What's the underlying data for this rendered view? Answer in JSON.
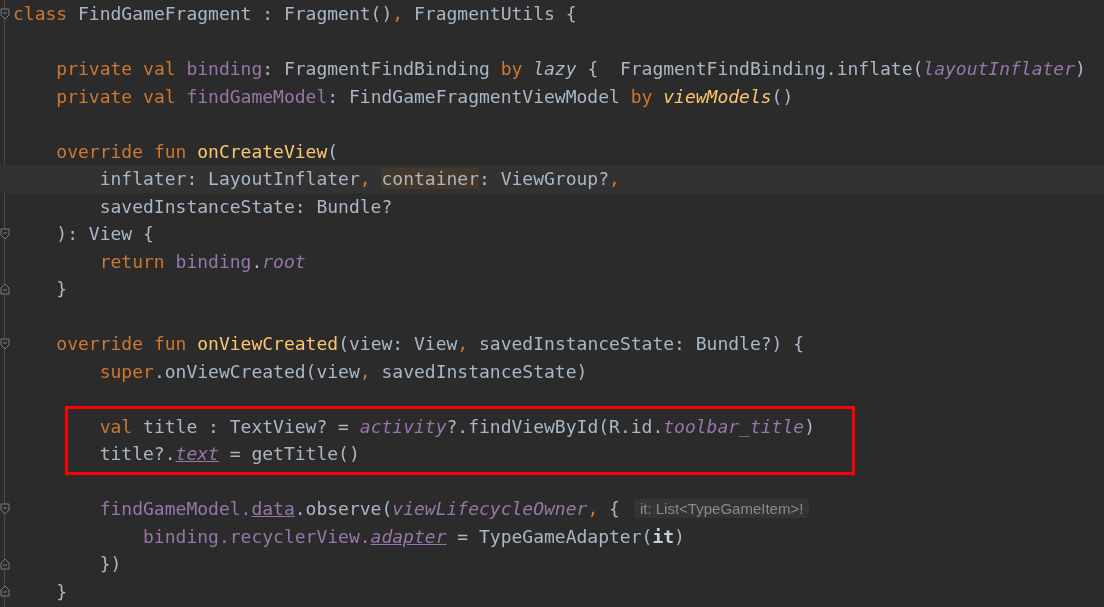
{
  "editor": {
    "lines": [
      {
        "kind": "code",
        "current": false,
        "boxed": false,
        "fold_start": true,
        "fold_end": false,
        "tokens": [
          {
            "kind": "keyword",
            "text": "class"
          },
          {
            "kind": "plain",
            "text": " FindGameFragment : Fragment()"
          },
          {
            "kind": "keyword",
            "text": ","
          },
          {
            "kind": "plain",
            "text": " FragmentUtils {"
          }
        ],
        "children": [
          {
            "kind": "blank",
            "current": false,
            "boxed": false,
            "fold_start": false,
            "fold_end": false
          },
          {
            "kind": "code",
            "current": false,
            "boxed": false,
            "fold_start": false,
            "fold_end": false,
            "tokens": [
              {
                "kind": "keyword",
                "text": "private val "
              },
              {
                "kind": "property",
                "text": "binding"
              },
              {
                "kind": "plain",
                "text": ": FragmentFindBinding "
              },
              {
                "kind": "keyword",
                "text": "by "
              },
              {
                "kind": "call_italic",
                "text": "lazy"
              },
              {
                "kind": "plain",
                "text": " {  FragmentFindBinding.inflate("
              },
              {
                "kind": "property_italic",
                "text": "layoutInflater"
              },
              {
                "kind": "plain",
                "text": ")"
              }
            ]
          },
          {
            "kind": "code",
            "current": false,
            "boxed": false,
            "fold_start": false,
            "fold_end": false,
            "tokens": [
              {
                "kind": "keyword",
                "text": "private val "
              },
              {
                "kind": "property",
                "text": "findGameModel"
              },
              {
                "kind": "plain",
                "text": ": FindGameFragmentViewModel "
              },
              {
                "kind": "keyword",
                "text": "by "
              },
              {
                "kind": "extension_italic",
                "text": "viewModels"
              },
              {
                "kind": "plain",
                "text": "()"
              }
            ]
          },
          {
            "kind": "blank",
            "current": false,
            "boxed": false,
            "fold_start": false,
            "fold_end": false
          },
          {
            "kind": "code",
            "current": false,
            "boxed": false,
            "fold_start": false,
            "fold_end": false,
            "tokens": [
              {
                "kind": "keyword",
                "text": "override fun "
              },
              {
                "kind": "declaration",
                "text": "onCreateView"
              },
              {
                "kind": "plain",
                "text": "("
              }
            ],
            "children": [
              {
                "kind": "code",
                "current": true,
                "boxed": false,
                "fold_start": false,
                "fold_end": false,
                "tokens": [
                  {
                    "kind": "plain",
                    "text": "inflater: LayoutInflater"
                  },
                  {
                    "kind": "keyword",
                    "text": ","
                  },
                  {
                    "kind": "usage",
                    "text": "container"
                  },
                  {
                    "kind": "plain",
                    "text": ": ViewGroup?"
                  },
                  {
                    "kind": "keyword",
                    "text": ","
                  }
                ]
              },
              {
                "kind": "code",
                "current": false,
                "boxed": false,
                "fold_start": false,
                "fold_end": false,
                "tokens": [
                  {
                    "kind": "plain",
                    "text": "savedInstanceState: Bundle?"
                  }
                ]
              }
            ]
          },
          {
            "kind": "code",
            "current": false,
            "boxed": false,
            "fold_start": true,
            "fold_end": false,
            "tokens": [
              {
                "kind": "plain",
                "text": "): View {"
              }
            ],
            "children": [
              {
                "kind": "code",
                "current": false,
                "boxed": false,
                "fold_start": false,
                "fold_end": false,
                "tokens": [
                  {
                    "kind": "keyword",
                    "text": "return "
                  },
                  {
                    "kind": "property",
                    "text": "binding"
                  },
                  {
                    "kind": "plain",
                    "text": "."
                  },
                  {
                    "kind": "property_italic",
                    "text": "root"
                  }
                ]
              }
            ]
          },
          {
            "kind": "code",
            "current": false,
            "boxed": false,
            "fold_start": false,
            "fold_end": true,
            "tokens": [
              {
                "kind": "plain",
                "text": "}"
              }
            ]
          },
          {
            "kind": "blank",
            "current": false,
            "boxed": false,
            "fold_start": false,
            "fold_end": false
          },
          {
            "kind": "code",
            "current": false,
            "boxed": false,
            "fold_start": true,
            "fold_end": false,
            "tokens": [
              {
                "kind": "keyword",
                "text": "override fun "
              },
              {
                "kind": "declaration",
                "text": "onViewCreated"
              },
              {
                "kind": "plain",
                "text": "(view: View"
              },
              {
                "kind": "keyword",
                "text": ","
              },
              {
                "kind": "plain",
                "text": " savedInstanceState: Bundle?) {"
              }
            ],
            "children": [
              {
                "kind": "code",
                "current": false,
                "boxed": false,
                "fold_start": false,
                "fold_end": false,
                "tokens": [
                  {
                    "kind": "keyword",
                    "text": "super"
                  },
                  {
                    "kind": "plain",
                    "text": ".onViewCreated(view"
                  },
                  {
                    "kind": "keyword",
                    "text": ","
                  },
                  {
                    "kind": "plain",
                    "text": " savedInstanceState)"
                  }
                ]
              },
              {
                "kind": "blank",
                "current": false,
                "boxed": false,
                "fold_start": false,
                "fold_end": false
              },
              {
                "kind": "code",
                "current": false,
                "boxed": true,
                "fold_start": false,
                "fold_end": false,
                "tokens": [
                  {
                    "kind": "keyword",
                    "text": "val "
                  },
                  {
                    "kind": "plain",
                    "text": "title : TextView? = "
                  },
                  {
                    "kind": "property_italic",
                    "text": "activity"
                  },
                  {
                    "kind": "plain",
                    "text": "?.findViewById(R.id."
                  },
                  {
                    "kind": "property_italic",
                    "text": "toolbar_title"
                  },
                  {
                    "kind": "plain",
                    "text": ")"
                  }
                ]
              },
              {
                "kind": "code",
                "current": false,
                "boxed": true,
                "fold_start": false,
                "fold_end": false,
                "tokens": [
                  {
                    "kind": "plain",
                    "text": "title?."
                  },
                  {
                    "kind": "property_link",
                    "text": "text"
                  },
                  {
                    "kind": "plain",
                    "text": " = getTitle()"
                  }
                ]
              },
              {
                "kind": "blank",
                "current": false,
                "boxed": false,
                "fold_start": false,
                "fold_end": false
              },
              {
                "kind": "code",
                "current": false,
                "boxed": false,
                "fold_start": true,
                "fold_end": false,
                "hint": "it: List<TypeGameItem>!",
                "tokens": [
                  {
                    "kind": "property",
                    "text": "findGameModel."
                  },
                  {
                    "kind": "property_underlined",
                    "text": "data"
                  },
                  {
                    "kind": "plain",
                    "text": ".observe("
                  },
                  {
                    "kind": "property_italic",
                    "text": "viewLifecycleOwner"
                  },
                  {
                    "kind": "keyword",
                    "text": ","
                  },
                  {
                    "kind": "plain",
                    "text": " {"
                  }
                ],
                "children": [
                  {
                    "kind": "code",
                    "current": false,
                    "boxed": false,
                    "fold_start": false,
                    "fold_end": false,
                    "tokens": [
                      {
                        "kind": "property",
                        "text": "binding.recyclerView."
                      },
                      {
                        "kind": "property_link",
                        "text": "adapter"
                      },
                      {
                        "kind": "plain",
                        "text": " = TypeGameAdapter("
                      },
                      {
                        "kind": "bold",
                        "text": "it"
                      },
                      {
                        "kind": "plain",
                        "text": ")"
                      }
                    ]
                  }
                ]
              },
              {
                "kind": "code",
                "current": false,
                "boxed": false,
                "fold_start": false,
                "fold_end": true,
                "tokens": [
                  {
                    "kind": "plain",
                    "text": "})"
                  }
                ]
              }
            ]
          },
          {
            "kind": "code",
            "current": false,
            "boxed": false,
            "fold_start": false,
            "fold_end": true,
            "tokens": [
              {
                "kind": "plain",
                "text": "}"
              }
            ]
          }
        ]
      }
    ]
  }
}
